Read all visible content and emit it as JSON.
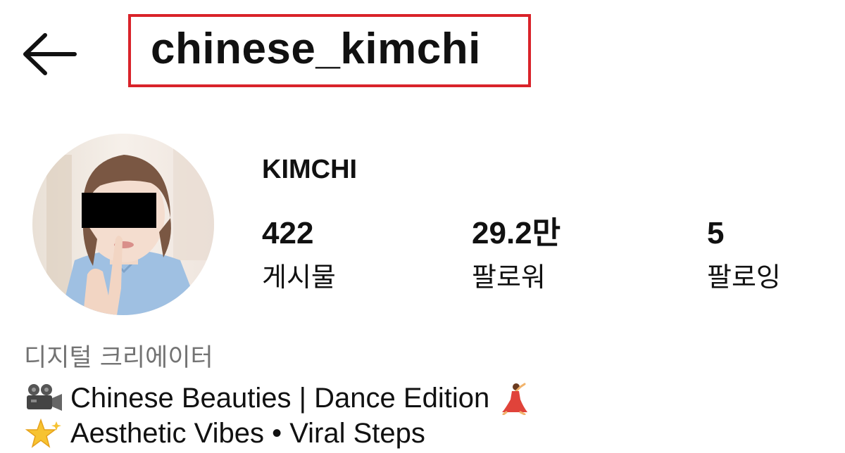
{
  "header": {
    "username": "chinese_kimchi",
    "back_icon": "arrow-left-icon",
    "highlight_color": "#d9232a"
  },
  "profile": {
    "display_name": "KIMCHI",
    "avatar_icon": "profile-photo",
    "stats": [
      {
        "value": "422",
        "label": "게시물"
      },
      {
        "value": "29.2만",
        "label": "팔로워"
      },
      {
        "value": "5",
        "label": "팔로잉"
      }
    ],
    "category": "디지털 크리에이터",
    "category_color": "#737373",
    "bio": [
      {
        "icon": "movie-camera-icon",
        "text": "Chinese Beauties | Dance Edition",
        "trail_icon": "dancing-woman-icon"
      },
      {
        "icon": "glowing-star-icon",
        "text": "Aesthetic Vibes • Viral Steps"
      }
    ]
  }
}
